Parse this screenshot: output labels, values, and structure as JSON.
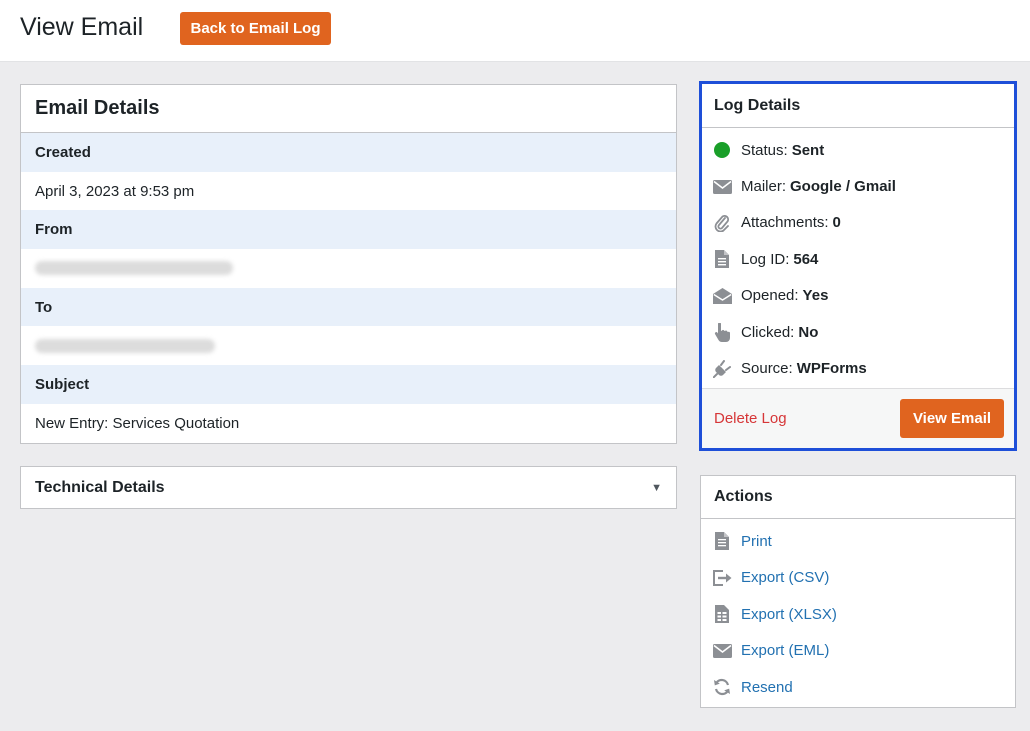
{
  "header": {
    "title": "View Email",
    "back_button": "Back to Email Log"
  },
  "email_details": {
    "title": "Email Details",
    "fields": [
      {
        "label": "Created",
        "value": "April 3, 2023 at 9:53 pm"
      },
      {
        "label": "From",
        "value": ""
      },
      {
        "label": "To",
        "value": ""
      },
      {
        "label": "Subject",
        "value": "New Entry: Services Quotation"
      }
    ]
  },
  "technical_details": {
    "title": "Technical Details"
  },
  "log_details": {
    "title": "Log Details",
    "items": [
      {
        "label": "Status:",
        "value": "Sent",
        "icon": "green-dot-icon"
      },
      {
        "label": "Mailer:",
        "value": "Google / Gmail",
        "icon": "envelope-icon"
      },
      {
        "label": "Attachments:",
        "value": "0",
        "icon": "paperclip-icon"
      },
      {
        "label": "Log ID:",
        "value": "564",
        "icon": "document-icon"
      },
      {
        "label": "Opened:",
        "value": "Yes",
        "icon": "open-envelope-icon"
      },
      {
        "label": "Clicked:",
        "value": "No",
        "icon": "pointer-hand-icon"
      },
      {
        "label": "Source:",
        "value": "WPForms",
        "icon": "plug-icon"
      }
    ],
    "delete_label": "Delete Log",
    "view_label": "View Email"
  },
  "actions": {
    "title": "Actions",
    "items": [
      {
        "label": "Print",
        "icon": "print-document-icon"
      },
      {
        "label": "Export (CSV)",
        "icon": "export-icon"
      },
      {
        "label": "Export (XLSX)",
        "icon": "spreadsheet-icon"
      },
      {
        "label": "Export (EML)",
        "icon": "envelope-icon"
      },
      {
        "label": "Resend",
        "icon": "refresh-icon"
      }
    ]
  },
  "colors": {
    "accent": "#e0641f",
    "highlight_border": "#1e4fd8",
    "link": "#2271b1",
    "danger": "#d63638",
    "status_green": "#1a9f29"
  }
}
